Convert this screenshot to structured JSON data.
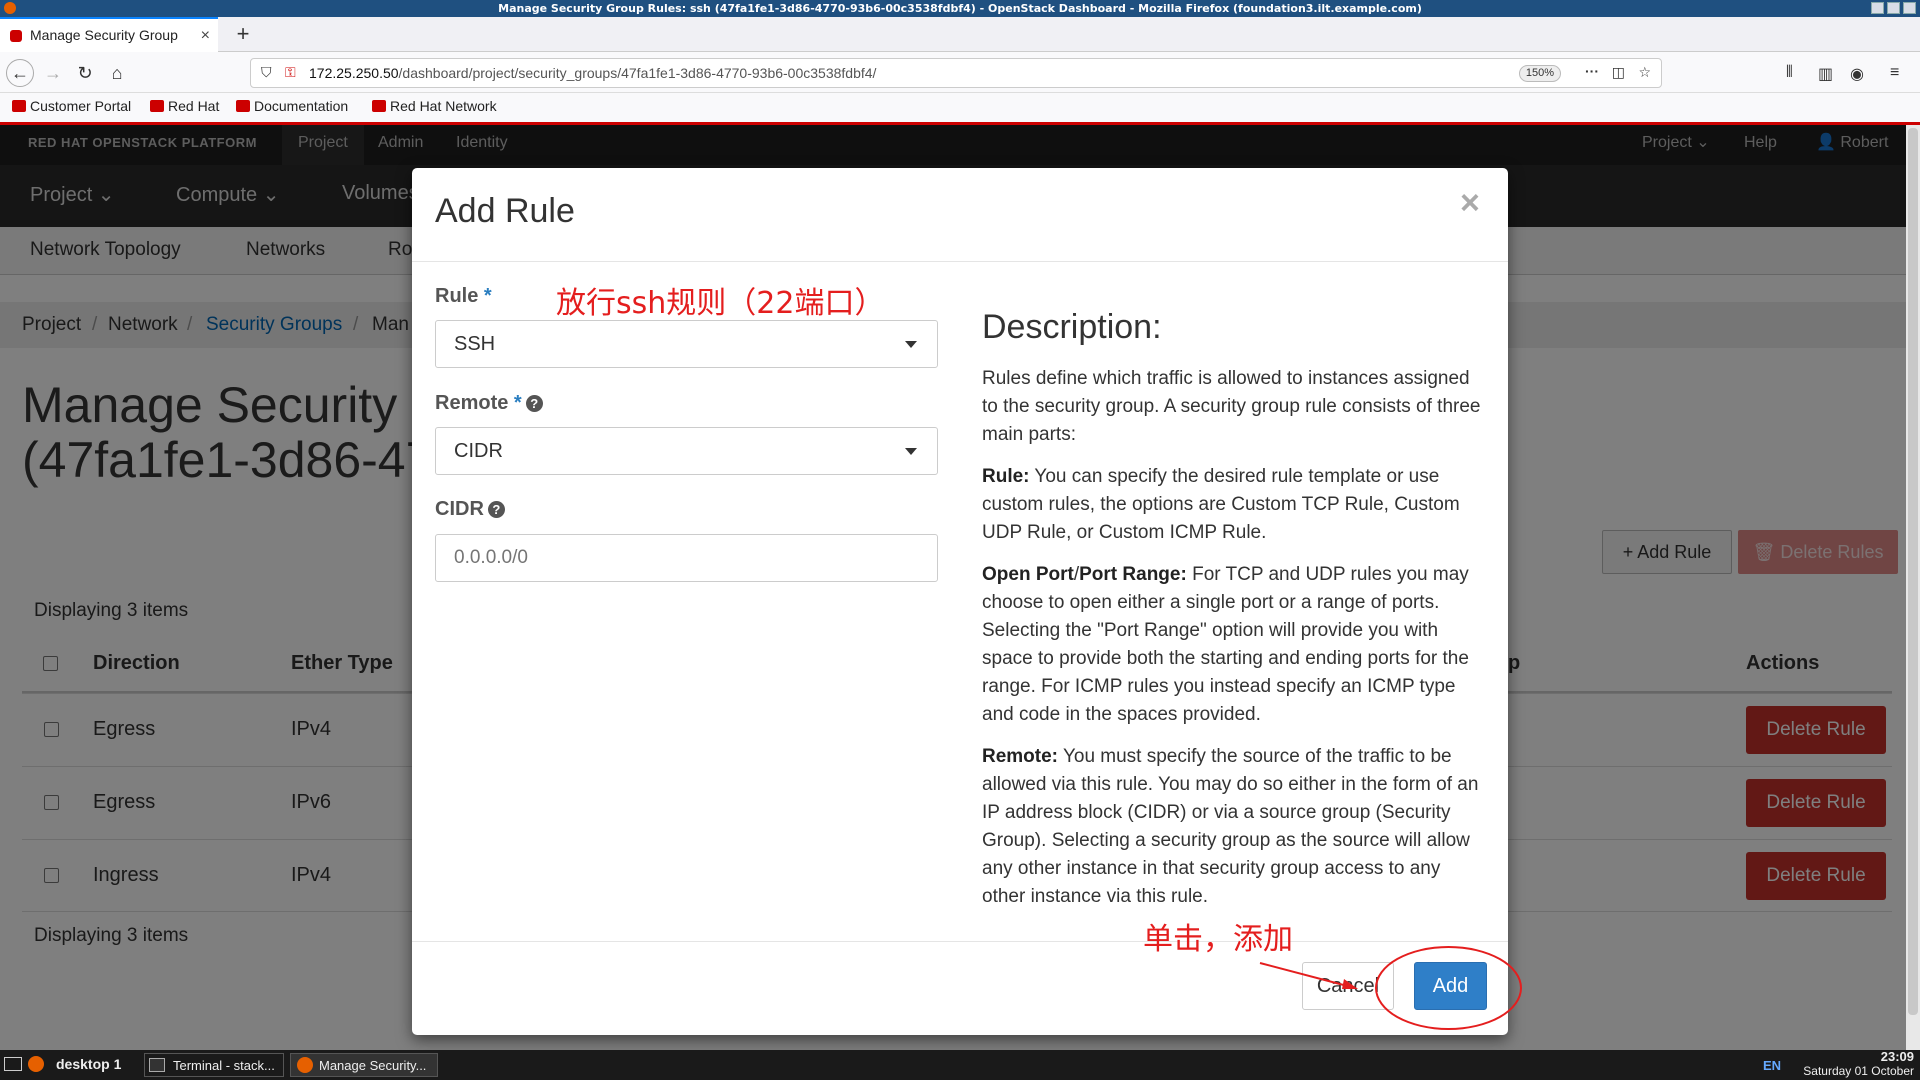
{
  "window": {
    "title": "Manage Security Group Rules: ssh (47fa1fe1-3d86-4770-93b6-00c3538fdbf4) - OpenStack Dashboard - Mozilla Firefox (foundation3.ilt.example.com)"
  },
  "browser": {
    "tab_title": "Manage Security Group",
    "new_tab": "+",
    "url_host": "172.25.250.50",
    "url_path": "/dashboard/project/security_groups/47fa1fe1-3d86-4770-93b6-00c3538fdbf4/",
    "zoom": "150%",
    "bookmarks": [
      "Customer Portal",
      "Red Hat",
      "Documentation",
      "Red Hat Network"
    ]
  },
  "openstack": {
    "brand": "RED HAT OPENSTACK PLATFORM",
    "top_nav": [
      "Project",
      "Admin",
      "Identity"
    ],
    "right_nav": {
      "project": "Project ⌄",
      "help": "Help",
      "user": "Robert ⌄"
    },
    "sub_nav": [
      "Project ⌄",
      "Compute ⌄",
      "Volumes"
    ],
    "third_nav": [
      "Network Topology",
      "Networks",
      "Ro"
    ],
    "breadcrumb": [
      "Project",
      "Network",
      "Security Groups",
      "Man"
    ],
    "page_title_1": "Manage Security G",
    "page_title_2": "(47fa1fe1-3d86-47",
    "add_rule_button": "+ Add Rule",
    "delete_rules_button": "🗑 Delete Rules",
    "displaying": "Displaying 3 items",
    "columns": {
      "direction": "Direction",
      "ether_type": "Ether Type",
      "group_tail": "p",
      "actions": "Actions"
    },
    "rows": [
      {
        "direction": "Egress",
        "ether_type": "IPv4",
        "action": "Delete Rule"
      },
      {
        "direction": "Egress",
        "ether_type": "IPv6",
        "action": "Delete Rule"
      },
      {
        "direction": "Ingress",
        "ether_type": "IPv4",
        "action": "Delete Rule"
      }
    ]
  },
  "modal": {
    "title": "Add Rule",
    "close": "×",
    "rule_label": "Rule",
    "rule_value": "SSH",
    "remote_label": "Remote",
    "remote_value": "CIDR",
    "cidr_label": "CIDR",
    "cidr_placeholder": "0.0.0.0/0",
    "required_mark": "*",
    "help_mark": "?",
    "desc_title": "Description:",
    "desc_intro": "Rules define which traffic is allowed to instances assigned to the security group. A security group rule consists of three main parts:",
    "desc_rule_head": "Rule:",
    "desc_rule": " You can specify the desired rule template or use custom rules, the options are Custom TCP Rule, Custom UDP Rule, or Custom ICMP Rule.",
    "desc_port_head": "Open Port",
    "desc_port_sep": "/",
    "desc_port_head2": "Port Range:",
    "desc_port": " For TCP and UDP rules you may choose to open either a single port or a range of ports. Selecting the \"Port Range\" option will provide you with space to provide both the starting and ending ports for the range. For ICMP rules you instead specify an ICMP type and code in the spaces provided.",
    "desc_remote_head": "Remote:",
    "desc_remote": " You must specify the source of the traffic to be allowed via this rule. You may do so either in the form of an IP address block (CIDR) or via a source group (Security Group). Selecting a security group as the source will allow any other instance in that security group access to any other instance via this rule.",
    "cancel": "Cancel",
    "add": "Add"
  },
  "annotations": {
    "rule_note": "放行ssh规则（22端口）",
    "add_note": "单击，添加",
    "color": "#e41e1e"
  },
  "taskbar": {
    "desktop": "desktop 1",
    "tasks": [
      "Terminal - stack...",
      "Manage Security..."
    ],
    "lang": "EN",
    "time": "23:09",
    "date": "Saturday 01 October"
  }
}
